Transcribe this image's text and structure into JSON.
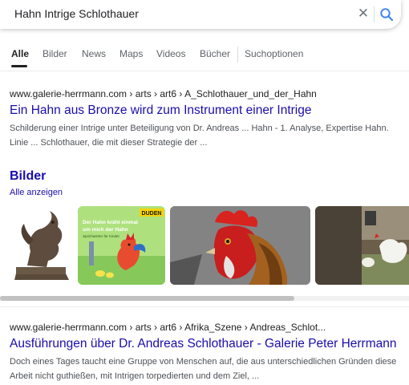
{
  "search": {
    "query": "Hahn Intrige Schlothauer",
    "clear_icon": "close-icon",
    "search_icon": "search-icon"
  },
  "tabs": [
    {
      "label": "Alle",
      "active": true
    },
    {
      "label": "Bilder"
    },
    {
      "label": "News"
    },
    {
      "label": "Maps"
    },
    {
      "label": "Videos"
    },
    {
      "label": "Bücher"
    },
    {
      "label": "Suchoptionen"
    }
  ],
  "result1": {
    "url": "www.galerie-herrmann.com › arts › art6 › A_Schlothauer_und_der_Hahn",
    "title": "Ein Hahn aus Bronze wird zum Instrument einer Intrige",
    "snippet": "Schilderung einer Intrige unter Beteiligung von Dr. Andreas ... Hahn - 1. Analyse, Expertise Hahn. Linie ... Schlothauer, die mit dieser Strategie der ..."
  },
  "images": {
    "heading": "Bilder",
    "show_all": "Alle anzeigen",
    "thumb2_badge": "DUDEN",
    "thumb2_text_line1": "Der Hahn kräht einmal",
    "thumb2_text_line2": "um mich der Hahn",
    "thumb2_caption": "Sprichwörter für Kinder"
  },
  "result2": {
    "url": "www.galerie-herrmann.com › arts › art6 › Afrika_Szene › Andreas_Schlot...",
    "title": "Ausführungen über Dr. Andreas Schlothauer - Galerie Peter Herrmann",
    "snippet": "Doch eines Tages taucht eine Gruppe von Menschen auf, die aus unterschiedlichen Gründen diese Arbeit nicht guthießen, mit Intrigen torpedierten und dem Ziel, ..."
  },
  "colors": {
    "link": "#1a0dab",
    "snippet": "#4d5156",
    "search_blue": "#4285f4"
  }
}
